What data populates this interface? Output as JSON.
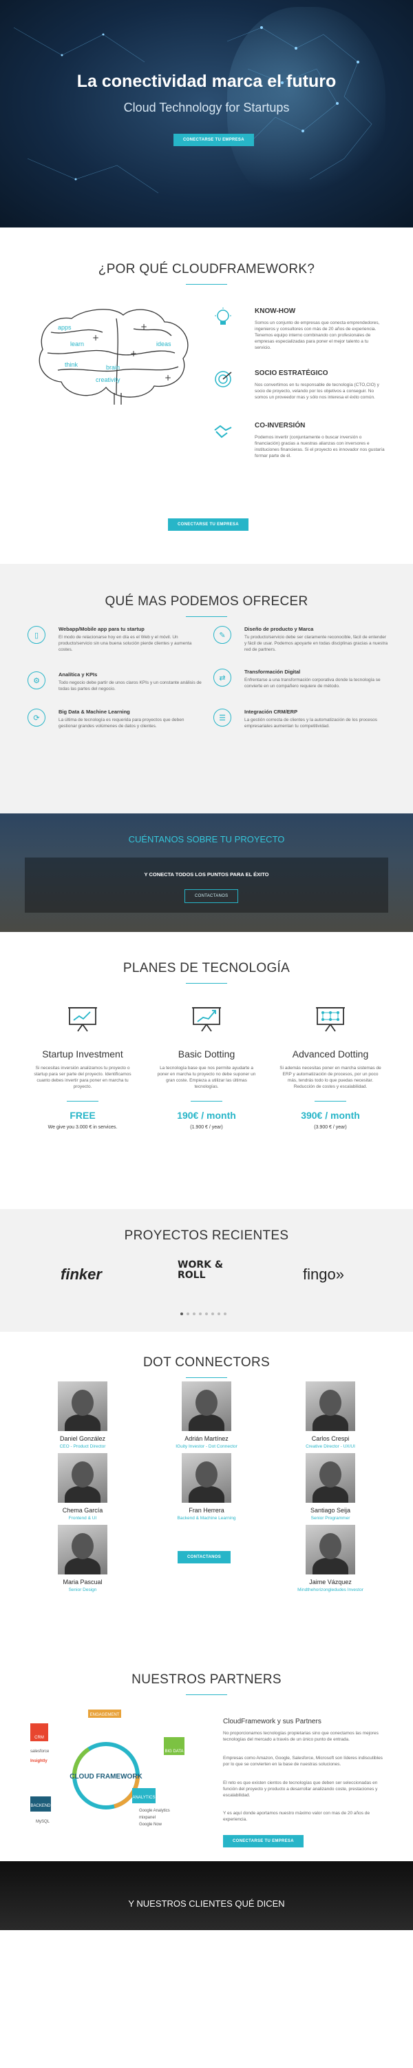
{
  "hero": {
    "title": "La conectividad marca el futuro",
    "subtitle": "Cloud Technology for Startups",
    "button": "Conectarse tu empresa"
  },
  "why": {
    "title": "¿POR QUÉ CLOUDFRAMEWORK?",
    "brain_words": [
      "apps",
      "learn",
      "ideas",
      "think",
      "brain",
      "creativity"
    ],
    "features": [
      {
        "icon": "bulb-icon",
        "title": "KNOW-HOW",
        "text": "Somos un conjunto de empresas que conecta emprendedores, ingenieros y consultores con más de 20 años de experiencia. Tenemos equipo interno combinando con profesionales de empresas especializadas para poner el mejor talento a tu servicio."
      },
      {
        "icon": "target-icon",
        "title": "SOCIO ESTRATÉGICO",
        "text": "Nos convertimos en tu responsable de tecnología (CTO,CIO) y socio de proyecto, velando por los objetivos a conseguir. No somos un proveedor mas y sólo nos interesa el éxito común."
      },
      {
        "icon": "handshake-icon",
        "title": "CO-INVERSIÓN",
        "text": "Podemos invertir (conjuntamente o buscar inversión o financiación) gracias a nuestras alianzas con inversores e instituciones financieras. Si el proyecto es innovador nos gustaría formar parte de él."
      }
    ],
    "button": "Conectarse tu empresa"
  },
  "services": {
    "title": "QUÉ MAS PODEMOS OFRECER",
    "items": [
      {
        "icon": "smartphone-icon",
        "glyph": "▯",
        "title": "Webapp/Mobile app para tu startup",
        "text": "El modo de relacionarse hoy en día es el Web y el móvil. Un producto/servicio sin una buena solución pierde clientes y aumenta costes."
      },
      {
        "icon": "pen-icon",
        "glyph": "✎",
        "title": "Diseño de producto y Marca",
        "text": "Tu producto/servicio debe ser claramente reconocible, fácil de entender y fácil de usar. Podemos apoyarte en todas disciplinas gracias a nuestra red de partners."
      },
      {
        "icon": "analytics-icon",
        "glyph": "⚙",
        "title": "Analítica y KPIs",
        "text": "Todo negocio debe partir de unos claros KPIs y un constante análisis de todas las partes del negocio."
      },
      {
        "icon": "transform-icon",
        "glyph": "⇄",
        "title": "Transformación Digital",
        "text": "Enfrentarse a una transformación corporativa donde la tecnología se convierte en un compañero requiere de método."
      },
      {
        "icon": "database-icon",
        "glyph": "⟳",
        "title": "Big Data & Machine Learning",
        "text": "La última de tecnología es requerida para proyectos que deben gestionar grandes volúmenes de datos y clientes."
      },
      {
        "icon": "crm-icon",
        "glyph": "☰",
        "title": "Integración CRM/ERP",
        "text": "La gestión correcta de clientes y la automatización de los procesos empresariales aumentan tu competitividad."
      }
    ]
  },
  "cta": {
    "title": "CUÉNTANOS SOBRE TU PROYECTO",
    "text": "Y CONECTA TODOS LOS PUNTOS PARA EL ÉXITO",
    "button": "Contactanos"
  },
  "plans": {
    "title": "PLANES DE TECNOLOGÍA",
    "items": [
      {
        "name": "Startup Investment",
        "text": "Si necesitas inversión analizamos tu proyecto o startup para ser parte del proyecto. Identificamos cuanto debes invertir para poner en marcha tu proyecto.",
        "price": "FREE",
        "note": "We give you 3.000 € in services."
      },
      {
        "name": "Basic Dotting",
        "text": "La tecnología base que nos permite ayudarte a poner en marcha tu proyecto no debe suponer un gran coste. Empieza a utilizar las últimas tecnologías.",
        "price": "190€ / month",
        "note": "(1.900 € / year)"
      },
      {
        "name": "Advanced Dotting",
        "text": "Si además necesitas poner en marcha sistemas de ERP y automatización de procesos, por un poco más, tendrás todo lo que puedas necesitar. Reducción de costes y escalabilidad.",
        "price": "390€ / month",
        "note": "(3.900 € / year)"
      }
    ]
  },
  "projects": {
    "title": "PROYECTOS RECIENTES",
    "logos": [
      "finker",
      "WORK & ROLL",
      "fingo»"
    ]
  },
  "team": {
    "title": "DOT CONNECTORS",
    "members": [
      {
        "name": "Daniel González",
        "role": "CEO - Product Director"
      },
      {
        "name": "Adrián Martínez",
        "role": "IGuity Investor - Dot Connector"
      },
      {
        "name": "Carlos Crespi",
        "role": "Creative Director - UX/UI"
      },
      {
        "name": "Chema García",
        "role": "Frontend & UI"
      },
      {
        "name": "Fran Herrera",
        "role": "Backend & Machine Learning"
      },
      {
        "name": "Santiago Seija",
        "role": "Senior Programmer"
      },
      {
        "name": "Maria Pascual",
        "role": "Senior Design"
      },
      {
        "name": "Jaime Vázquez",
        "role": "Mindthehorizongledudes Investor"
      }
    ],
    "button": "Contactanos"
  },
  "partners": {
    "title": "NUESTROS PARTNERS",
    "diagram": {
      "center": "CLOUD FRAMEWORK",
      "labels": [
        "ENGAGEMENT",
        "CRM",
        "BIG DATA",
        "BACKEND",
        "ANALYTICS"
      ],
      "brands": [
        "salesforce",
        "Insightly",
        "Google Analytics",
        "mixpanel",
        "Google Now",
        "MySQL"
      ]
    },
    "subtitle": "CloudFramework y sus Partners",
    "paras": [
      "No proporcionamos tecnologías propietarias sino que conectamos las mejores tecnologías del mercado a través de un único punto de entrada.",
      "Empresas como Amazon, Google, Salesforce, Microsoft son líderes indiscutibles por lo que se convierten en la base de nuestras soluciones.",
      "El reto es que existen cientos de tecnologías que deben ser seleccionadas en función del proyecto y producto a desarrollar analizando coste, prestaciones y escalabilidad.",
      "Y es aquí donde aportamos nuestro máximo valor con mas de 20 años de experiencia."
    ],
    "button": "Conectarse tu empresa"
  },
  "clients": {
    "title": "Y NUESTROS CLIENTES QUÉ DICEN"
  },
  "colors": {
    "accent": "#27b5c8",
    "dark": "#132a45",
    "light_bg": "#f2f2f2"
  }
}
